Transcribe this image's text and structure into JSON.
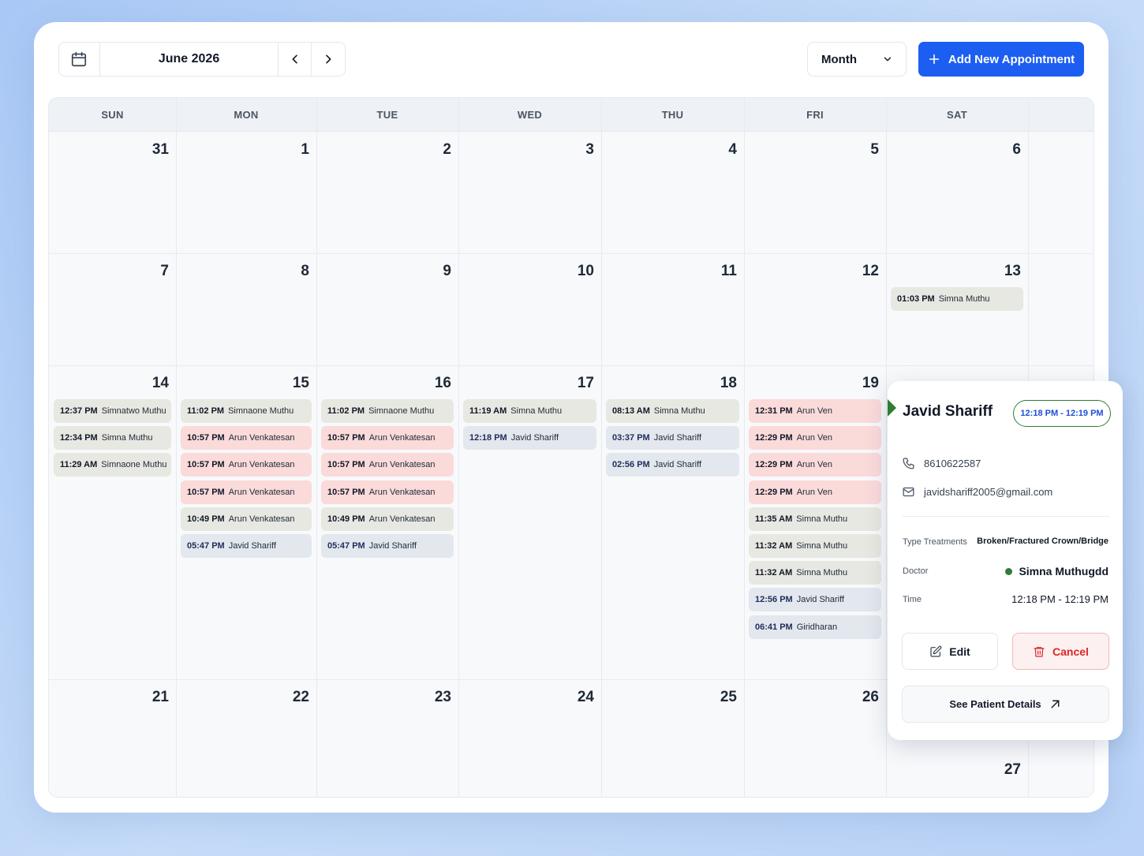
{
  "toolbar": {
    "month_label": "June 2026",
    "view": "Month",
    "add_label": "Add New Appointment"
  },
  "weekdays": [
    "SUN",
    "MON",
    "TUE",
    "WED",
    "THU",
    "FRI",
    "SAT"
  ],
  "weeks": [
    [
      "31",
      "1",
      "2",
      "3",
      "4",
      "5",
      "6"
    ],
    [
      "7",
      "8",
      "9",
      "10",
      "11",
      "12",
      "13"
    ],
    [
      "14",
      "15",
      "16",
      "17",
      "18",
      "19",
      ""
    ],
    [
      "21",
      "22",
      "23",
      "24",
      "25",
      "26",
      "27"
    ]
  ],
  "events": {
    "d13": [
      {
        "time": "01:03 PM",
        "name": "Simna Muthu",
        "status": "green"
      }
    ],
    "d14": [
      {
        "time": "12:37 PM",
        "name": "Simnatwo Muthu",
        "status": "green"
      },
      {
        "time": "12:34 PM",
        "name": "Simna Muthu",
        "status": "green"
      },
      {
        "time": "11:29 AM",
        "name": "Simnaone Muthu",
        "status": "green"
      }
    ],
    "d15": [
      {
        "time": "11:02 PM",
        "name": "Simnaone Muthu",
        "status": "green"
      },
      {
        "time": "10:57 PM",
        "name": "Arun Venkatesan",
        "status": "red"
      },
      {
        "time": "10:57 PM",
        "name": "Arun Venkatesan",
        "status": "red"
      },
      {
        "time": "10:57 PM",
        "name": "Arun Venkatesan",
        "status": "red"
      },
      {
        "time": "10:49 PM",
        "name": "Arun Venkatesan",
        "status": "green"
      },
      {
        "time": "05:47 PM",
        "name": "Javid Shariff",
        "status": "blue"
      }
    ],
    "d16": [
      {
        "time": "11:02 PM",
        "name": "Simnaone Muthu",
        "status": "green"
      },
      {
        "time": "10:57 PM",
        "name": "Arun Venkatesan",
        "status": "red"
      },
      {
        "time": "10:57 PM",
        "name": "Arun Venkatesan",
        "status": "red"
      },
      {
        "time": "10:57 PM",
        "name": "Arun Venkatesan",
        "status": "red"
      },
      {
        "time": "10:49 PM",
        "name": "Arun Venkatesan",
        "status": "green"
      },
      {
        "time": "05:47 PM",
        "name": "Javid Shariff",
        "status": "blue"
      }
    ],
    "d17": [
      {
        "time": "11:19 AM",
        "name": "Simna Muthu",
        "status": "green"
      },
      {
        "time": "12:18 PM",
        "name": "Javid Shariff",
        "status": "blue"
      }
    ],
    "d18": [
      {
        "time": "08:13 AM",
        "name": "Simna Muthu",
        "status": "green"
      },
      {
        "time": "03:37 PM",
        "name": "Javid Shariff",
        "status": "blue"
      },
      {
        "time": "02:56 PM",
        "name": "Javid Shariff",
        "status": "blue"
      }
    ],
    "d19": [
      {
        "time": "12:31 PM",
        "name": "Arun Ven",
        "status": "red"
      },
      {
        "time": "12:29 PM",
        "name": "Arun Ven",
        "status": "red"
      },
      {
        "time": "12:29 PM",
        "name": "Arun Ven",
        "status": "red"
      },
      {
        "time": "12:29 PM",
        "name": "Arun Ven",
        "status": "red"
      },
      {
        "time": "11:35 AM",
        "name": "Simna Muthu",
        "status": "green"
      },
      {
        "time": "11:32 AM",
        "name": "Simna Muthu",
        "status": "green"
      },
      {
        "time": "11:32 AM",
        "name": "Simna Muthu",
        "status": "green"
      },
      {
        "time": "12:56 PM",
        "name": "Javid Shariff",
        "status": "blue"
      },
      {
        "time": "06:41 PM",
        "name": "Giridharan",
        "status": "blue"
      }
    ]
  },
  "popover": {
    "name": "Javid Shariff",
    "time_badge": "12:18 PM - 12:19 PM",
    "phone": "8610622587",
    "email": "javidshariff2005@gmail.com",
    "treatment_label": "Type Treatments",
    "treatment_value": "Broken/Fractured Crown/Bridge",
    "doctor_label": "Doctor",
    "doctor_value": "Simna Muthugdd",
    "time_label": "Time",
    "time_value": "12:18 PM - 12:19 PM",
    "edit_label": "Edit",
    "cancel_label": "Cancel",
    "details_label": "See Patient Details"
  },
  "colors": {
    "accent": "#1d5ef2",
    "event_green": "#e7e8e1",
    "event_red": "#fbdada",
    "event_blue": "#e3e7ee",
    "doctor_dot": "#2e7d32",
    "cancel": "#dc2626"
  }
}
